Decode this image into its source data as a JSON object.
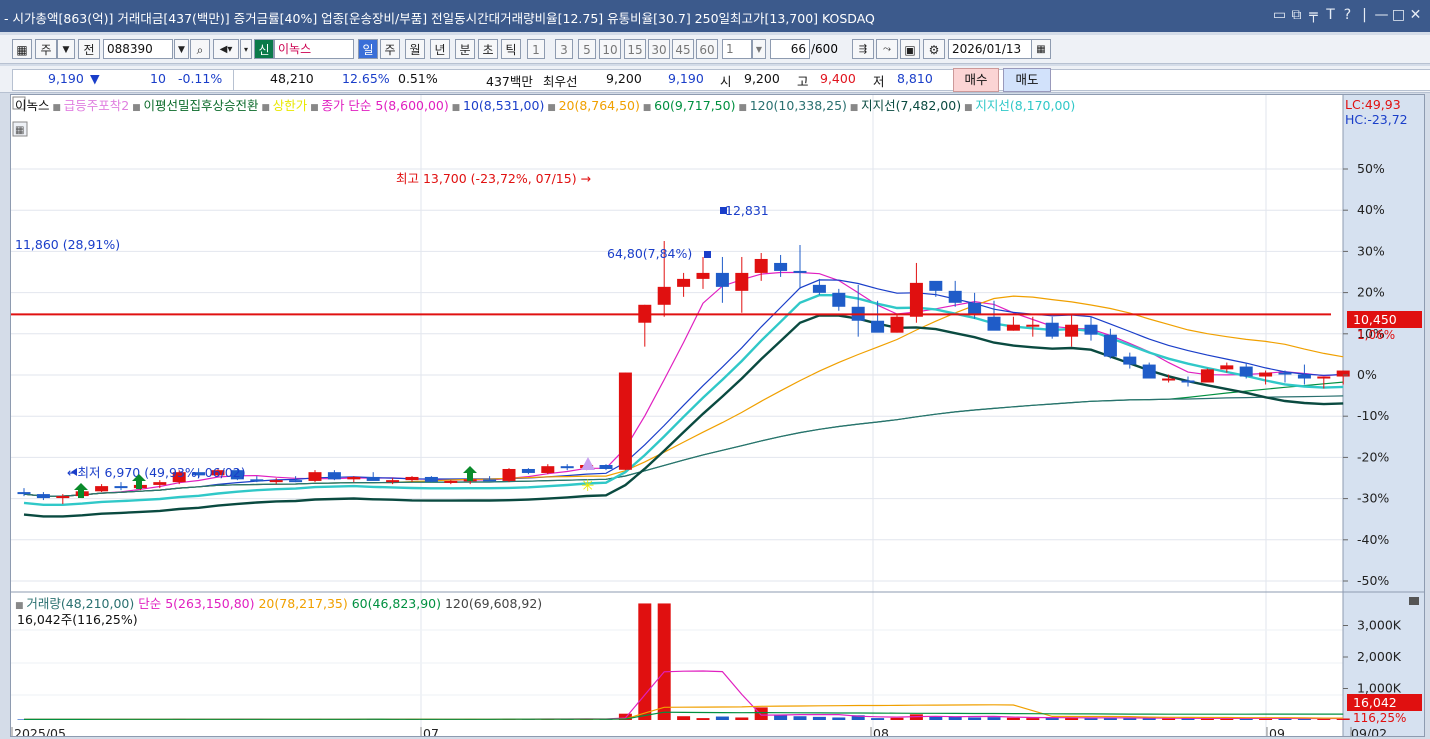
{
  "title_bar": {
    "text": "- 시가총액[863(억)]  거래대금[437(백만)]  증거금률[40%]  업종[운송장비/부품]  전일동시간대거래량비율[12.75]  유통비율[30.7]  250일최고가[13,700]  KOSDAQ",
    "controls": [
      "▭",
      "⧉",
      "╤",
      "T",
      "?",
      "|",
      "—",
      "□",
      "✕"
    ]
  },
  "toolbar": {
    "code_type": "주",
    "all_label": "전",
    "stock_code": "088390",
    "new_badge": "신",
    "stock_name": "이녹스",
    "periods": [
      "일",
      "주",
      "월",
      "년",
      "분",
      "초",
      "틱"
    ],
    "intervals": [
      "1",
      "3",
      "5",
      "10",
      "15",
      "30",
      "45",
      "60"
    ],
    "unit_value": "1",
    "count_value": "66",
    "count_total": "/600",
    "date": "2026/01/13"
  },
  "quote_bar": {
    "price": "9,190",
    "direction": "▼",
    "change": "10",
    "change_rate": "-0.11%",
    "volume": "48,210",
    "volume_ratio": "12.65%",
    "turnover_rate": "0.51%",
    "amount": "437백만",
    "best_bid_label": "최우선",
    "ask": "9,200",
    "bid": "9,190",
    "open_label": "시",
    "open": "9,200",
    "high_label": "고",
    "high": "9,400",
    "low_label": "저",
    "low": "8,810",
    "buy_button": "매수",
    "sell_button": "매도"
  },
  "price_legend": {
    "name": "이녹스",
    "items": [
      {
        "text": "급등주포착2",
        "color": "#e080e0"
      },
      {
        "text": "이평선밀집후상승전환",
        "color": "#0b6a2a"
      },
      {
        "text": "상한가",
        "color": "#e8e800"
      },
      {
        "text": "종가 단순 5(8,600,00)",
        "color": "#e020c0"
      },
      {
        "text": "10(8,531,00)",
        "color": "#1a3ec9"
      },
      {
        "text": "20(8,764,50)",
        "color": "#f0a000"
      },
      {
        "text": "60(9,717,50)",
        "color": "#009040"
      },
      {
        "text": "120(10,338,25)",
        "color": "#2a7070"
      },
      {
        "text": "지지선(7,482,00)",
        "color": "#0a4a40"
      },
      {
        "text": "지지선(8,170,00)",
        "color": "#30c8c8"
      }
    ],
    "lc": "LC:49,93",
    "hc": "HC:-23,72"
  },
  "volume_legend": {
    "items": [
      {
        "text": "거래량(48,210,00)",
        "color": "#2a7070"
      },
      {
        "text": "단순 5(263,150,80)",
        "color": "#e020c0"
      },
      {
        "text": "20(78,217,35)",
        "color": "#f0a000"
      },
      {
        "text": "60(46,823,90)",
        "color": "#009040"
      },
      {
        "text": "120(69,608,92)",
        "color": "#444444"
      }
    ],
    "sub": "16,042주(116,25%)"
  },
  "annotations": {
    "high_marker": "최고 13,700 (-23,72%, 07/15) →",
    "low_marker": "←최저 6,970 (49,93%, 06/02)",
    "hline_label": "11,860 (28,91%)",
    "peak_label": "12,831",
    "mid_label": "64,80(7,84%)"
  },
  "price_badge": {
    "value": "10,450",
    "pct": "1,06%"
  },
  "volume_badge": {
    "value": "16,042",
    "pct": "116,25%"
  },
  "x_axis_labels": [
    "2025/05",
    "07",
    "08",
    "09",
    "09/02"
  ],
  "chart_data": {
    "type": "candlestick",
    "price_axis_pct": [
      "50%",
      "40%",
      "30%",
      "20%",
      "10%",
      "0%",
      "-10%",
      "-20%",
      "-30%",
      "-40%",
      "-50%"
    ],
    "volume_axis": [
      "3,000K",
      "2,000K",
      "1,000K"
    ],
    "hline_price": 11860,
    "candles": [
      [
        7400,
        7500,
        7300,
        7350
      ],
      [
        7350,
        7400,
        7200,
        7250
      ],
      [
        7250,
        7350,
        7100,
        7300
      ],
      [
        7300,
        7450,
        7250,
        7420
      ],
      [
        7420,
        7600,
        7400,
        7550
      ],
      [
        7550,
        7650,
        7450,
        7500
      ],
      [
        7500,
        7600,
        7450,
        7580
      ],
      [
        7580,
        7700,
        7500,
        7650
      ],
      [
        7650,
        7950,
        7600,
        7900
      ],
      [
        7900,
        8000,
        7750,
        7820
      ],
      [
        7820,
        8000,
        7800,
        7950
      ],
      [
        7950,
        7980,
        7700,
        7720
      ],
      [
        7720,
        7800,
        7650,
        7680
      ],
      [
        7680,
        7750,
        7600,
        7700
      ],
      [
        7700,
        7800,
        7650,
        7680
      ],
      [
        7680,
        7950,
        7650,
        7900
      ],
      [
        7900,
        7950,
        7700,
        7720
      ],
      [
        7720,
        7800,
        7650,
        7780
      ],
      [
        7780,
        7900,
        7700,
        7680
      ],
      [
        7680,
        7750,
        7600,
        7700
      ],
      [
        7700,
        7800,
        7650,
        7780
      ],
      [
        7780,
        7800,
        7650,
        7660
      ],
      [
        7660,
        7700,
        7600,
        7680
      ],
      [
        7680,
        7800,
        7600,
        7720
      ],
      [
        7720,
        7800,
        7680,
        7680
      ],
      [
        7680,
        8000,
        7650,
        7980
      ],
      [
        7980,
        8000,
        7850,
        7880
      ],
      [
        7880,
        8100,
        7850,
        8050
      ],
      [
        8050,
        8100,
        7950,
        8000
      ],
      [
        8000,
        8100,
        7950,
        8080
      ],
      [
        8080,
        8100,
        7950,
        7980
      ],
      [
        7960,
        10400,
        7950,
        10400
      ],
      [
        11650,
        12100,
        11050,
        12100
      ],
      [
        12100,
        13700,
        11800,
        12550
      ],
      [
        12550,
        12900,
        12300,
        12750
      ],
      [
        12750,
        13300,
        12500,
        12900
      ],
      [
        12900,
        13300,
        12150,
        12550
      ],
      [
        12450,
        13300,
        11900,
        12900
      ],
      [
        12900,
        13400,
        12700,
        13250
      ],
      [
        13150,
        13350,
        12800,
        12950
      ],
      [
        12950,
        13600,
        12500,
        12900
      ],
      [
        12600,
        12750,
        12350,
        12400
      ],
      [
        12400,
        12500,
        11950,
        12050
      ],
      [
        12050,
        12600,
        11300,
        11700
      ],
      [
        11700,
        12200,
        11450,
        11400
      ],
      [
        11400,
        11850,
        11400,
        11800
      ],
      [
        11800,
        13150,
        11650,
        12650
      ],
      [
        12700,
        12500,
        12300,
        12450
      ],
      [
        12450,
        12700,
        12050,
        12150
      ],
      [
        12150,
        12400,
        11750,
        11850
      ],
      [
        11800,
        12200,
        11600,
        11450
      ],
      [
        11450,
        11800,
        11450,
        11600
      ],
      [
        11600,
        11800,
        11300,
        11600
      ],
      [
        11650,
        11800,
        11250,
        11300
      ],
      [
        11300,
        11850,
        11050,
        11600
      ],
      [
        11600,
        11800,
        11200,
        11350
      ],
      [
        11350,
        11500,
        10750,
        10800
      ],
      [
        10800,
        10900,
        10500,
        10600
      ],
      [
        10600,
        10650,
        10250,
        10250
      ],
      [
        10250,
        10350,
        10150,
        10250
      ],
      [
        10200,
        10300,
        10050,
        10150
      ],
      [
        10150,
        10500,
        10150,
        10480
      ],
      [
        10480,
        10650,
        10400,
        10580
      ],
      [
        10550,
        10650,
        10250,
        10300
      ],
      [
        10300,
        10450,
        10100,
        10400
      ],
      [
        10400,
        10450,
        10150,
        10350
      ],
      [
        10350,
        10600,
        10100,
        10250
      ],
      [
        10250,
        10300,
        10000,
        10300
      ],
      [
        10300,
        10450,
        10100,
        10450
      ]
    ],
    "volumes": [
      20,
      15,
      25,
      18,
      30,
      20,
      18,
      22,
      40,
      25,
      28,
      22,
      20,
      18,
      20,
      35,
      25,
      22,
      30,
      20,
      25,
      18,
      20,
      24,
      20,
      45,
      30,
      40,
      28,
      25,
      30,
      200,
      3700,
      3700,
      120,
      60,
      110,
      80,
      400,
      150,
      120,
      100,
      80,
      150,
      60,
      70,
      180,
      120,
      100,
      80,
      90,
      70,
      60,
      80,
      70,
      60,
      75,
      55,
      50,
      45,
      50,
      60,
      50,
      45,
      48,
      50,
      45,
      44,
      48
    ]
  }
}
